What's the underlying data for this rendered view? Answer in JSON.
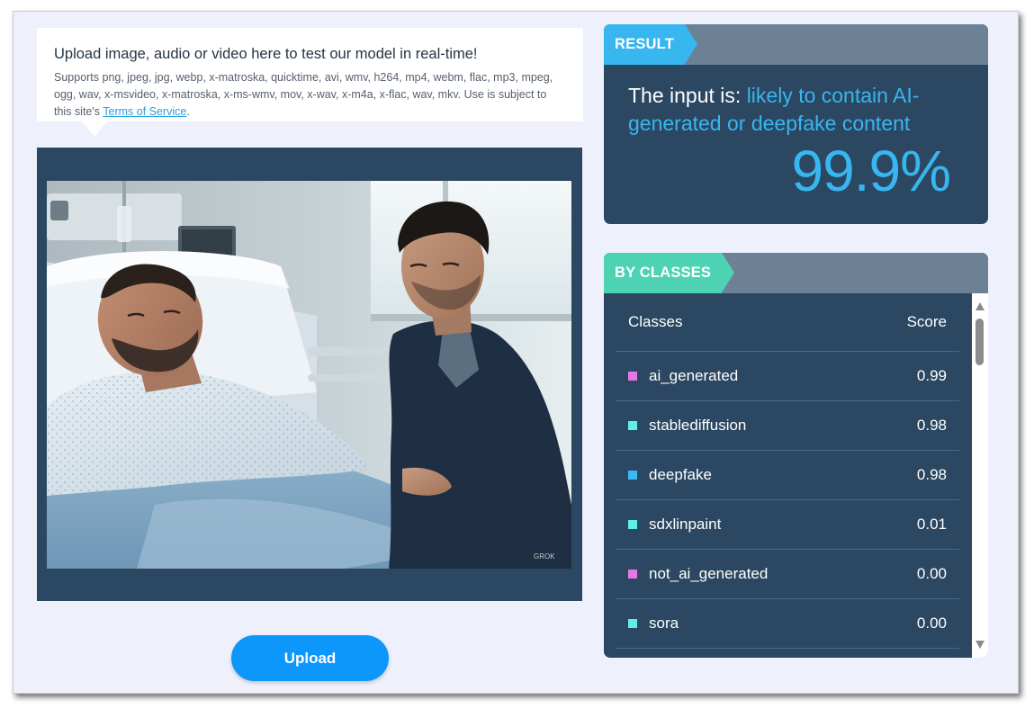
{
  "info": {
    "heading": "Upload image, audio or video here to test our model in real-time!",
    "desc_prefix": "Supports png, jpeg, jpg, webp, x-matroska, quicktime, avi, wmv, h264, mp4, webm, flac, mp3, mpeg, ogg, wav, x-msvideo, x-matroska, x-ms-wmv, mov, x-wav, x-m4a, x-flac, wav, mkv. Use is subject to this site's ",
    "terms_link": "Terms of Service",
    "desc_suffix": "."
  },
  "media": {
    "watermark": "GROK"
  },
  "upload": {
    "label": "Upload"
  },
  "result": {
    "tag": "RESULT",
    "prefix": "The input is: ",
    "verdict": "likely to contain AI-generated or deepfake content",
    "percent": "99.9%"
  },
  "classes": {
    "tag": "BY CLASSES",
    "col_class": "Classes",
    "col_score": "Score",
    "rows": [
      {
        "name": "ai_generated",
        "score": "0.99",
        "color": "#e27ae6"
      },
      {
        "name": "stablediffusion",
        "score": "0.98",
        "color": "#5ff0e4"
      },
      {
        "name": "deepfake",
        "score": "0.98",
        "color": "#3cb8f5"
      },
      {
        "name": "sdxlinpaint",
        "score": "0.01",
        "color": "#5ff0e4"
      },
      {
        "name": "not_ai_generated",
        "score": "0.00",
        "color": "#e27ae6"
      },
      {
        "name": "sora",
        "score": "0.00",
        "color": "#5ff0e4"
      }
    ]
  }
}
